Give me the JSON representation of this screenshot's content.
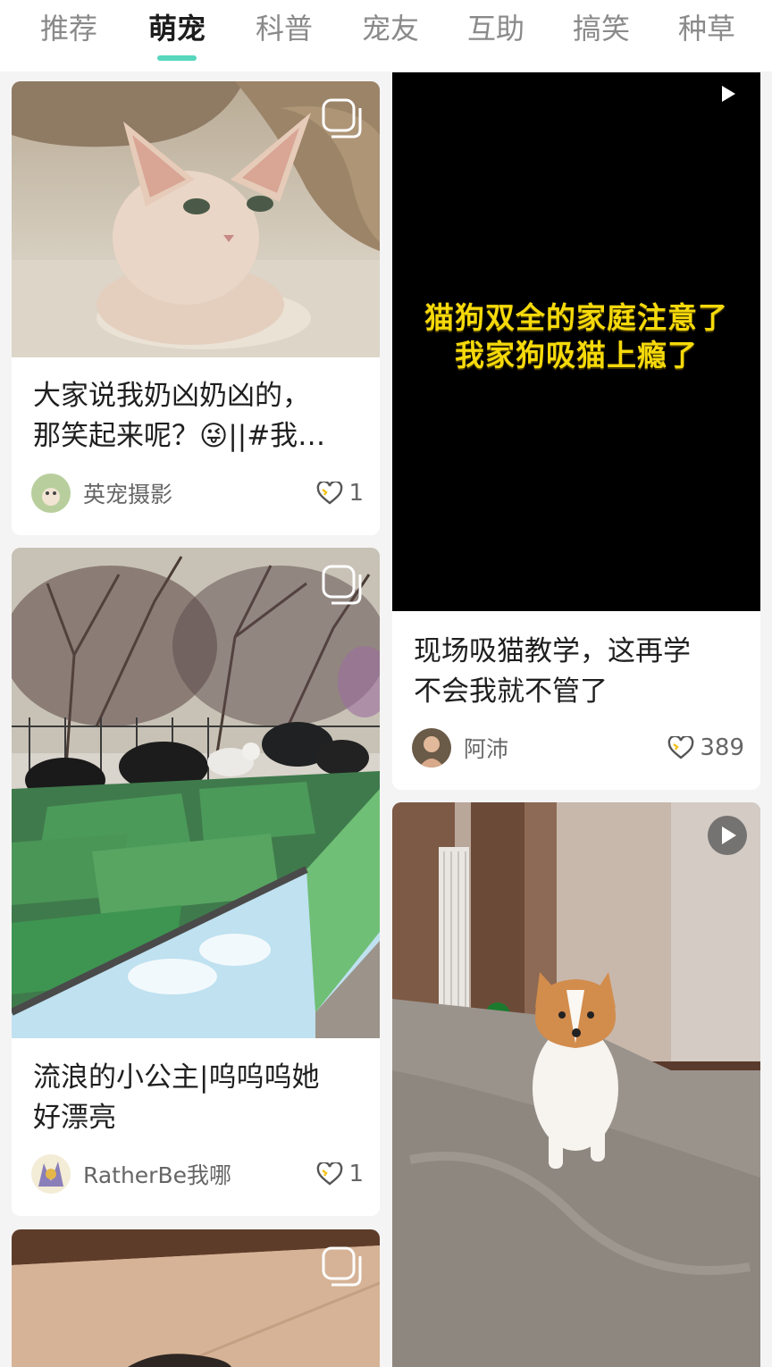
{
  "tabs": [
    {
      "label": "推荐",
      "active": false
    },
    {
      "label": "萌宠",
      "active": true
    },
    {
      "label": "科普",
      "active": false
    },
    {
      "label": "宠友",
      "active": false
    },
    {
      "label": "互助",
      "active": false
    },
    {
      "label": "搞笑",
      "active": false
    },
    {
      "label": "种草",
      "active": false
    }
  ],
  "accent_color": "#56d6bd",
  "cards": [
    {
      "title_line1": "大家说我奶凶奶凶的，",
      "title_line2": "那笑起来呢？😜||#我…",
      "author": "英宠摄影",
      "likes": "1",
      "media_type": "image-set",
      "media_icon": "multi-image-icon",
      "media_subject": "cat"
    },
    {
      "video_caption_line1": "猫狗双全的家庭注意了",
      "video_caption_line2": "我家狗吸猫上瘾了",
      "title_line1": "现场吸猫教学，这再学",
      "title_line2": "不会我就不管了",
      "author": "阿沛",
      "likes": "389",
      "media_type": "video",
      "media_icon": "play-icon"
    },
    {
      "title_line1": "流浪的小公主|呜呜呜她",
      "title_line2": "好漂亮",
      "author": "RatherBe我哪",
      "likes": "1",
      "media_type": "image-set",
      "media_icon": "multi-image-icon",
      "media_subject": "white cat on bins"
    },
    {
      "media_type": "video",
      "media_icon": "play-icon",
      "media_subject": "corgi"
    },
    {
      "media_type": "image-set",
      "media_icon": "multi-image-icon"
    }
  ]
}
